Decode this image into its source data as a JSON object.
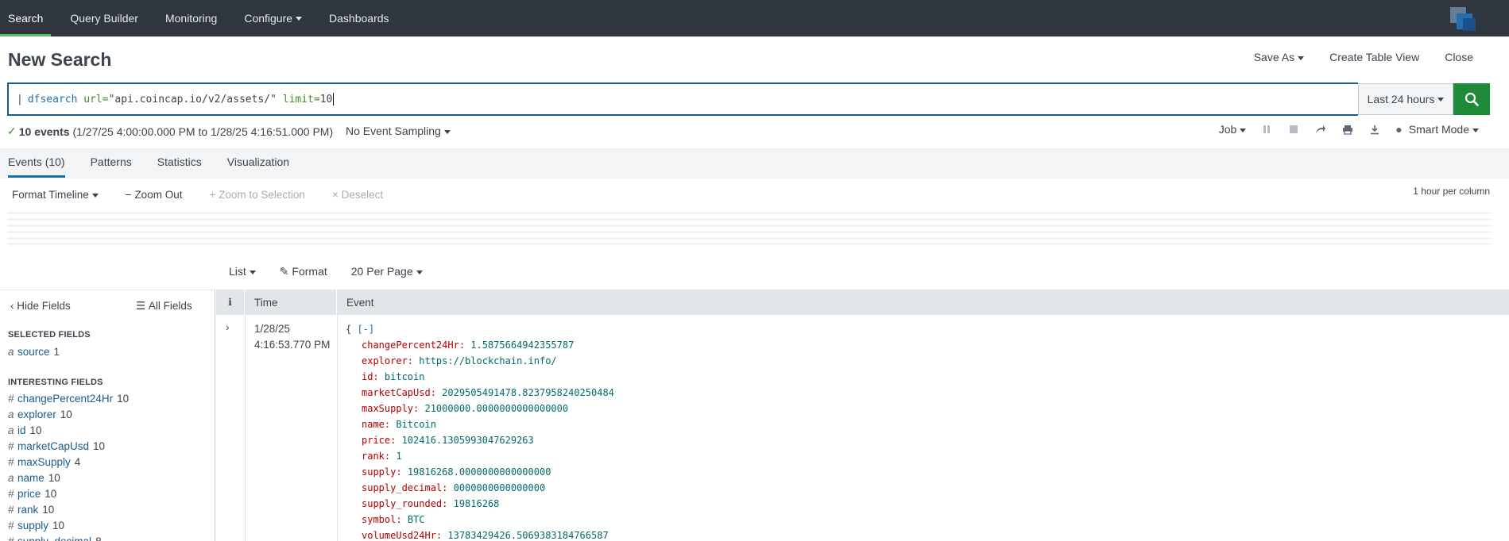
{
  "nav": {
    "items": [
      "Search",
      "Query Builder",
      "Monitoring",
      "Configure",
      "Dashboards"
    ],
    "active": "Search"
  },
  "page": {
    "title": "New Search",
    "save_as": "Save As",
    "create_table_view": "Create Table View",
    "close": "Close"
  },
  "search": {
    "pipe": "|",
    "command": "dfsearch",
    "arg1": "url=",
    "arg1_value": "\"api.coincap.io/v2/assets/\"",
    "arg2": "limit=",
    "arg2_value": "10",
    "time_range": "Last 24 hours"
  },
  "status": {
    "events": "10 events",
    "range": "(1/27/25 4:00:00.000 PM to 1/28/25 4:16:51.000 PM)",
    "sampling": "No Event Sampling",
    "job": "Job",
    "mode": "Smart Mode"
  },
  "tabs": [
    "Events (10)",
    "Patterns",
    "Statistics",
    "Visualization"
  ],
  "timeline": {
    "format": "Format Timeline",
    "zoom_out": "Zoom Out",
    "zoom_selection": "Zoom to Selection",
    "deselect": "Deselect",
    "per_column": "1 hour per column"
  },
  "results": {
    "list": "List",
    "format": "Format",
    "per_page": "20 Per Page"
  },
  "sidebar": {
    "hide_fields": "Hide Fields",
    "all_fields": "All Fields",
    "selected_heading": "SELECTED FIELDS",
    "interesting_heading": "INTERESTING FIELDS",
    "selected": [
      {
        "type": "a",
        "name": "source",
        "count": "1"
      }
    ],
    "interesting": [
      {
        "type": "#",
        "name": "changePercent24Hr",
        "count": "10"
      },
      {
        "type": "a",
        "name": "explorer",
        "count": "10"
      },
      {
        "type": "a",
        "name": "id",
        "count": "10"
      },
      {
        "type": "#",
        "name": "marketCapUsd",
        "count": "10"
      },
      {
        "type": "#",
        "name": "maxSupply",
        "count": "4"
      },
      {
        "type": "a",
        "name": "name",
        "count": "10"
      },
      {
        "type": "#",
        "name": "price",
        "count": "10"
      },
      {
        "type": "#",
        "name": "rank",
        "count": "10"
      },
      {
        "type": "#",
        "name": "supply",
        "count": "10"
      },
      {
        "type": "#",
        "name": "supply_decimal",
        "count": "8"
      }
    ]
  },
  "table": {
    "col_info": "i",
    "col_time": "Time",
    "col_event": "Event"
  },
  "event": {
    "date": "1/28/25",
    "time": "4:16:53.770 PM",
    "open_brace": "{",
    "collapse": "[-]",
    "fields": [
      {
        "key": "changePercent24Hr",
        "value": "1.5875664942355787"
      },
      {
        "key": "explorer",
        "value": "https://blockchain.info/"
      },
      {
        "key": "id",
        "value": "bitcoin"
      },
      {
        "key": "marketCapUsd",
        "value": "2029505491478.8237958240250484"
      },
      {
        "key": "maxSupply",
        "value": "21000000.0000000000000000"
      },
      {
        "key": "name",
        "value": "Bitcoin"
      },
      {
        "key": "price",
        "value": "102416.1305993047629263"
      },
      {
        "key": "rank",
        "value": "1"
      },
      {
        "key": "supply",
        "value": "19816268.0000000000000000"
      },
      {
        "key": "supply_decimal",
        "value": "0000000000000000"
      },
      {
        "key": "supply_rounded",
        "value": "19816268"
      },
      {
        "key": "symbol",
        "value": "BTC"
      },
      {
        "key": "volumeUsd24Hr",
        "value": "13783429426.5069383184766587"
      }
    ]
  },
  "colors": {
    "nav_bg": "#2f363d",
    "active_underline": "#5cc05c",
    "search_button": "#1f8a3a",
    "tab_underline": "#1a6fb0",
    "json_key": "#b30000",
    "json_value": "#006b6b"
  }
}
